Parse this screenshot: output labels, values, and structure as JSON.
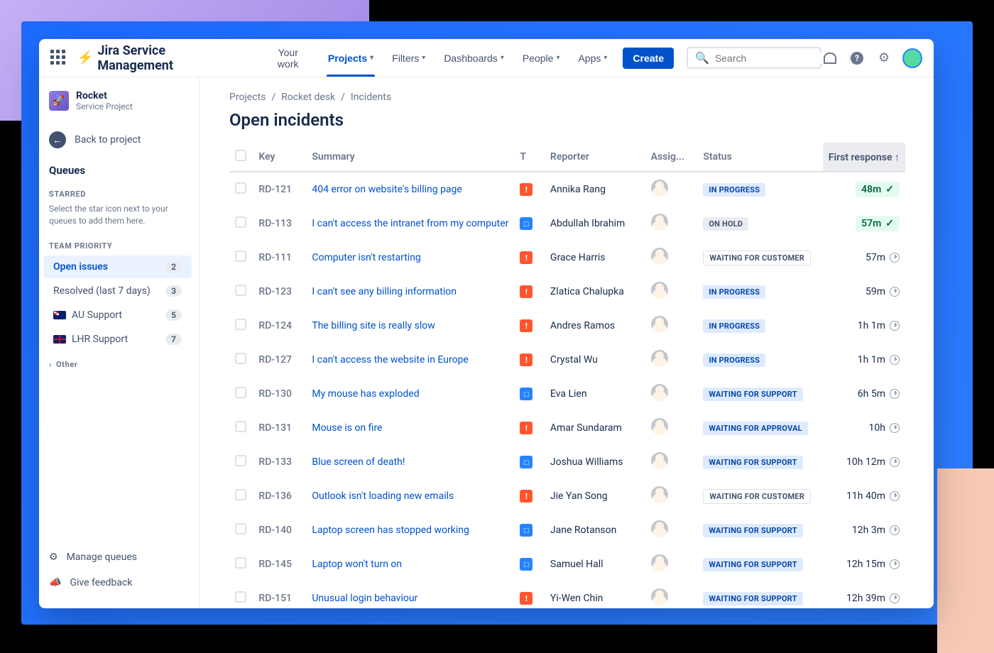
{
  "top": {
    "product": "Jira Service Management",
    "nav": {
      "your_work": "Your work",
      "projects": "Projects",
      "filters": "Filters",
      "dashboards": "Dashboards",
      "people": "People",
      "apps": "Apps"
    },
    "create": "Create",
    "search_placeholder": "Search",
    "slash": "/"
  },
  "sidebar": {
    "project_name": "Rocket",
    "project_type": "Service Project",
    "back": "Back to project",
    "queues_heading": "Queues",
    "starred_label": "Starred",
    "starred_hint": "Select the star icon next to your queues to add them here.",
    "team_priority_label": "Team Priority",
    "items": {
      "open_issues": {
        "label": "Open issues",
        "count": "2"
      },
      "resolved": {
        "label": "Resolved (last 7 days)",
        "count": "3"
      },
      "au_support": {
        "label": "AU Support",
        "count": "5"
      },
      "lhr_support": {
        "label": "LHR Support",
        "count": "7"
      }
    },
    "other_label": "Other",
    "manage_queues": "Manage queues",
    "give_feedback": "Give feedback"
  },
  "breadcrumb": {
    "a": "Projects",
    "b": "Rocket desk",
    "c": "Incidents"
  },
  "page_title": "Open incidents",
  "columns": {
    "key": "Key",
    "summary": "Summary",
    "t": "T",
    "reporter": "Reporter",
    "assignee": "Assig...",
    "status": "Status",
    "first_response": "First response ↑"
  },
  "status_labels": {
    "inprogress": "In Progress",
    "on_hold": "On Hold",
    "waiting_customer": "Waiting for Customer",
    "waiting_support": "Waiting for Support",
    "waiting_approval": "Waiting for Approval"
  },
  "rows": [
    {
      "key": "RD-121",
      "summary": "404 error on website's billing page",
      "t": "red",
      "reporter": "Annika Rang",
      "status": "inprogress",
      "fr": "48m",
      "ok": true
    },
    {
      "key": "RD-113",
      "summary": "I can't access the intranet from my computer",
      "t": "blue",
      "reporter": "Abdullah Ibrahim",
      "status": "on_hold",
      "fr": "57m",
      "ok": true
    },
    {
      "key": "RD-111",
      "summary": "Computer isn't restarting",
      "t": "red",
      "reporter": "Grace Harris",
      "status": "waiting_customer",
      "fr": "57m",
      "ok": false
    },
    {
      "key": "RD-123",
      "summary": "I can't see any billing information",
      "t": "red",
      "reporter": "Zlatica Chalupka",
      "status": "inprogress",
      "fr": "59m",
      "ok": false
    },
    {
      "key": "RD-124",
      "summary": "The billing site is really slow",
      "t": "red",
      "reporter": "Andres Ramos",
      "status": "inprogress",
      "fr": "1h 1m",
      "ok": false
    },
    {
      "key": "RD-127",
      "summary": "I can't access the website in Europe",
      "t": "red",
      "reporter": "Crystal Wu",
      "status": "inprogress",
      "fr": "1h 1m",
      "ok": false
    },
    {
      "key": "RD-130",
      "summary": "My mouse has exploded",
      "t": "blue",
      "reporter": "Eva Lien",
      "status": "waiting_support",
      "fr": "6h 5m",
      "ok": false
    },
    {
      "key": "RD-131",
      "summary": "Mouse is on fire",
      "t": "red",
      "reporter": "Amar Sundaram",
      "status": "waiting_approval",
      "fr": "10h",
      "ok": false
    },
    {
      "key": "RD-133",
      "summary": "Blue screen of death!",
      "t": "blue",
      "reporter": "Joshua Williams",
      "status": "waiting_support",
      "fr": "10h 12m",
      "ok": false
    },
    {
      "key": "RD-136",
      "summary": "Outlook isn't loading new emails",
      "t": "red",
      "reporter": "Jie Yan Song",
      "status": "waiting_customer",
      "fr": "11h 40m",
      "ok": false
    },
    {
      "key": "RD-140",
      "summary": "Laptop screen has stopped working",
      "t": "blue",
      "reporter": "Jane Rotanson",
      "status": "waiting_support",
      "fr": "12h 3m",
      "ok": false
    },
    {
      "key": "RD-145",
      "summary": "Laptop won't turn on",
      "t": "blue",
      "reporter": "Samuel Hall",
      "status": "waiting_support",
      "fr": "12h 15m",
      "ok": false
    },
    {
      "key": "RD-151",
      "summary": "Unusual login behaviour",
      "t": "red",
      "reporter": "Yi-Wen Chin",
      "status": "waiting_support",
      "fr": "12h 39m",
      "ok": false
    }
  ]
}
